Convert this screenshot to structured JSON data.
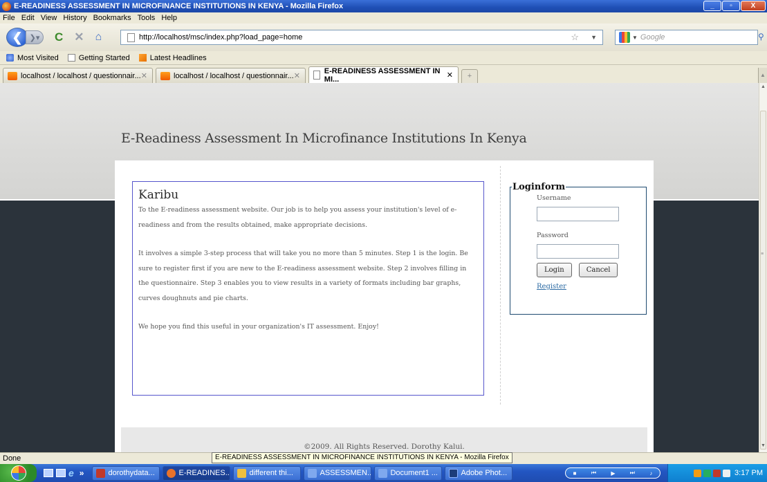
{
  "window": {
    "title": "E-READINESS ASSESSMENT IN MICROFINANCE INSTITUTIONS IN KENYA - Mozilla Firefox",
    "min": "_",
    "max": "▫",
    "close": "X"
  },
  "menu": [
    "File",
    "Edit",
    "View",
    "History",
    "Bookmarks",
    "Tools",
    "Help"
  ],
  "nav": {
    "url": "http://localhost/msc/index.php?load_page=home",
    "search_placeholder": "Google"
  },
  "bookmarks": [
    "Most Visited",
    "Getting Started",
    "Latest Headlines"
  ],
  "tabs": [
    {
      "label": "localhost / localhost / questionnair...",
      "icon": "phpmyadmin-icon",
      "active": false
    },
    {
      "label": "localhost / localhost / questionnair...",
      "icon": "phpmyadmin-icon",
      "active": false
    },
    {
      "label": "E-READINESS ASSESSMENT IN MI...",
      "icon": "page-icon",
      "active": true
    }
  ],
  "page": {
    "site_title": "E-Readiness Assessment In Microfinance Institutions In Kenya",
    "welcome": {
      "heading": "Karibu",
      "p1": "To the E-readiness assessment website. Our job is to help you assess your institution's level of e-readiness and from the results obtained, make appropriate decisions.",
      "p2": "It involves a simple 3-step process that will take you no more than 5 minutes. Step 1 is the login. Be sure to register first if you are new to the E-readiness assessment website. Step 2 involves filling in the questionnaire. Step 3 enables you to view results in a variety of formats including bar graphs, curves doughnuts and pie charts.",
      "p3": "We hope you find this useful in your organization's IT assessment. Enjoy!"
    },
    "login": {
      "legend": "Loginform",
      "username_label": "Username",
      "username_value": "",
      "password_label": "Password",
      "password_value": "",
      "login_button": "Login",
      "cancel_button": "Cancel",
      "register_link": "Register"
    },
    "footer": "©2009. All Rights Reserved. Dorothy Kalui."
  },
  "status": {
    "text": "Done",
    "tooltip": "E-READINESS ASSESSMENT IN MICROFINANCE INSTITUTIONS IN KENYA - Mozilla Firefox"
  },
  "taskbar": {
    "items": [
      {
        "label": "dorothydata...",
        "icon": "calendar-icon",
        "color": "#c0392b"
      },
      {
        "label": "E-READINES...",
        "icon": "firefox-icon",
        "color": "#e8722a"
      },
      {
        "label": "different thi...",
        "icon": "folder-icon",
        "color": "#f0c040"
      },
      {
        "label": "ASSESSMEN...",
        "icon": "word-icon",
        "color": "#3b6bc4"
      },
      {
        "label": "Document1 ...",
        "icon": "word-icon",
        "color": "#3b6bc4"
      },
      {
        "label": "Adobe Phot...",
        "icon": "photoshop-icon",
        "color": "#1c3c7a"
      }
    ],
    "clock": "3:17 PM"
  }
}
